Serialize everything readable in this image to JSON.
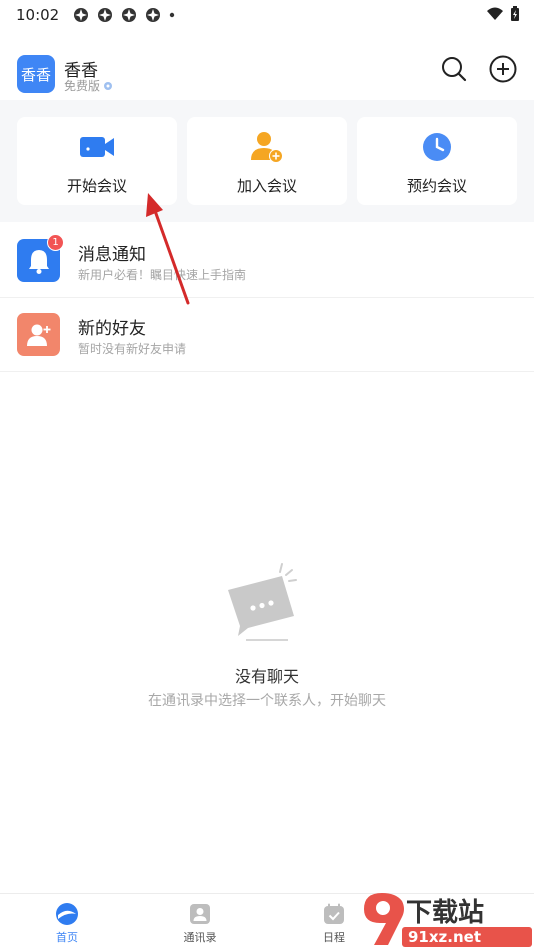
{
  "status_bar": {
    "time": "10:02"
  },
  "header": {
    "avatar_text": "香香",
    "user_name": "香香",
    "plan_label": "免费版"
  },
  "quick_actions": [
    {
      "label": "开始会议",
      "icon": "video-camera-icon",
      "color": "#2f7cf0"
    },
    {
      "label": "加入会议",
      "icon": "add-person-icon",
      "color": "#f5a623"
    },
    {
      "label": "预约会议",
      "icon": "clock-icon",
      "color": "#4a8cf5"
    }
  ],
  "list": [
    {
      "title": "消息通知",
      "subtitle": "新用户必看！瞩目快速上手指南",
      "badge": "1",
      "icon": "bell-icon",
      "color": "#2f7cf0"
    },
    {
      "title": "新的好友",
      "subtitle": "暂时没有新好友申请",
      "icon": "add-friend-icon",
      "color": "#f2866b"
    }
  ],
  "empty_state": {
    "title": "没有聊天",
    "subtitle": "在通讯录中选择一个联系人，开始聊天"
  },
  "bottom_nav": [
    {
      "label": "首页",
      "active": true
    },
    {
      "label": "通讯录",
      "active": false
    },
    {
      "label": "日程",
      "active": false
    }
  ],
  "watermark": {
    "main": "下载站",
    "number": "9",
    "site": "91xz.net"
  }
}
